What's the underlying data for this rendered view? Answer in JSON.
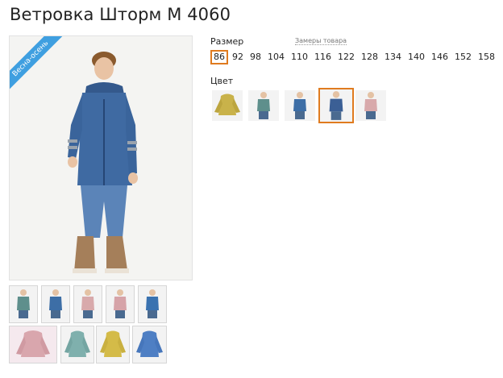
{
  "product": {
    "title": "Ветровка Шторм М 4060",
    "badge": "Весна-осень"
  },
  "options": {
    "size_label": "Размер",
    "size_chart_link": "Замеры товара",
    "sizes": [
      "86",
      "92",
      "98",
      "104",
      "110",
      "116",
      "122",
      "128",
      "134",
      "140",
      "146",
      "152",
      "158"
    ],
    "selected_size": "86",
    "color_label": "Цвет",
    "colors": [
      {
        "name": "mustard",
        "hex": "#c9b24a"
      },
      {
        "name": "teal",
        "hex": "#5e8f8c"
      },
      {
        "name": "blue",
        "hex": "#3d6ea6"
      },
      {
        "name": "navy-blue",
        "hex": "#3b5f95"
      },
      {
        "name": "pink",
        "hex": "#d8a9ab"
      }
    ],
    "selected_color": "navy-blue"
  },
  "gallery": {
    "row1": [
      "teal",
      "blue",
      "pink",
      "pink",
      "blue"
    ],
    "row2": [
      "pink",
      "teal",
      "mustard",
      "blue"
    ]
  },
  "accent": "#e07b1f"
}
